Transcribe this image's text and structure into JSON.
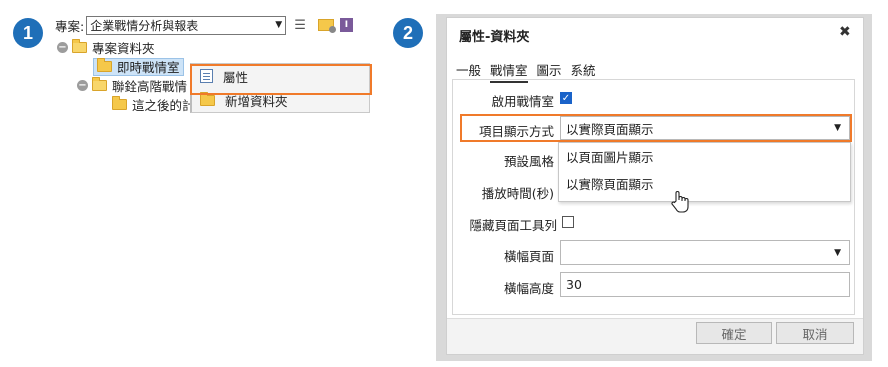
{
  "steps": {
    "one": "1",
    "two": "2"
  },
  "panel1": {
    "project_label": "專案:",
    "project_select": "企業戰情分析與報表",
    "tree": {
      "root": "專案資料夾",
      "selected": "即時戰情室",
      "sibling": "聯銓高階戰情",
      "child": "這之後的計"
    },
    "context_menu": {
      "properties": "屬性",
      "new_folder": "新增資料夾"
    }
  },
  "dialog": {
    "title": "屬性-資料夾",
    "close": "✖",
    "tabs": [
      "一般",
      "戰情室",
      "圖示",
      "系統"
    ],
    "fields": {
      "enable_label": "啟用戰情室",
      "display_mode_label": "項目顯示方式",
      "display_mode_value": "以實際頁面顯示",
      "default_style_label": "預設風格",
      "play_time_label": "播放時間(秒)",
      "hide_toolbar_label": "隱藏頁面工具列",
      "banner_page_label": "橫幅頁面",
      "banner_height_label": "橫幅高度",
      "banner_height_value": "30"
    },
    "dropdown_options": [
      "以頁面圖片顯示",
      "以實際頁面顯示"
    ],
    "buttons": {
      "ok": "確定",
      "cancel": "取消"
    }
  },
  "colors": {
    "accent_orange": "#f07a2a",
    "badge_blue": "#1f6fb8",
    "check_blue": "#1a63c9"
  }
}
